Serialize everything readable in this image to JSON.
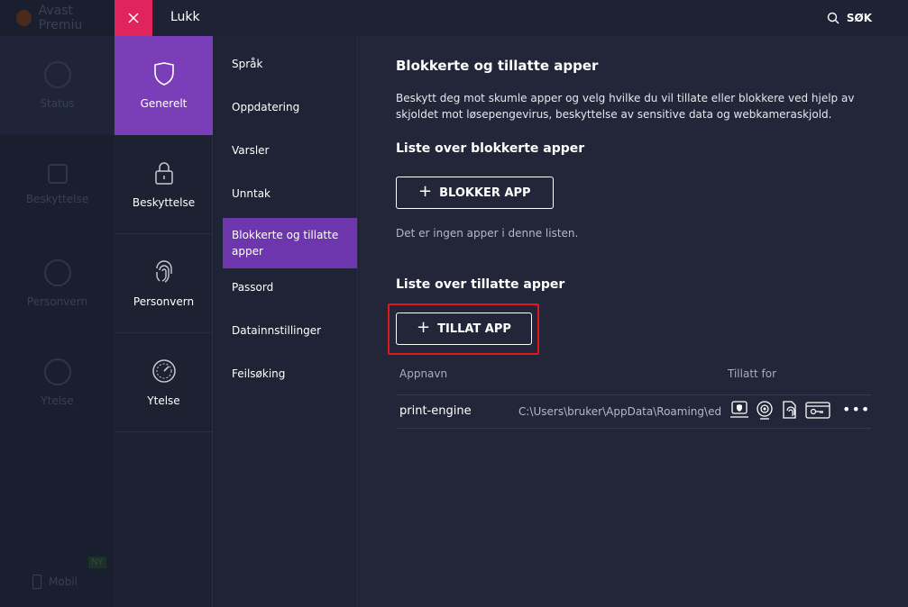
{
  "background_app": {
    "title": "Avast Premiu",
    "nav": [
      "Status",
      "Beskyttelse",
      "Personvern",
      "Ytelse"
    ],
    "mobil": "Mobil",
    "ny_badge": "NY"
  },
  "topbar": {
    "close_label": "Lukk",
    "search_label": "SØK"
  },
  "categories": [
    {
      "label": "Generelt",
      "icon": "shield-icon",
      "active": true
    },
    {
      "label": "Beskyttelse",
      "icon": "lock-icon",
      "active": false
    },
    {
      "label": "Personvern",
      "icon": "fingerprint-icon",
      "active": false
    },
    {
      "label": "Ytelse",
      "icon": "speedometer-icon",
      "active": false
    }
  ],
  "submenu": [
    {
      "label": "Språk",
      "active": false
    },
    {
      "label": "Oppdatering",
      "active": false
    },
    {
      "label": "Varsler",
      "active": false
    },
    {
      "label": "Unntak",
      "active": false
    },
    {
      "label": "Blokkerte og tillatte apper",
      "active": true
    },
    {
      "label": "Passord",
      "active": false
    },
    {
      "label": "Datainnstillinger",
      "active": false
    },
    {
      "label": "Feilsøking",
      "active": false
    }
  ],
  "content": {
    "title": "Blokkerte og tillatte apper",
    "description": "Beskytt deg mot skumle apper og velg hvilke du vil tillate eller blokkere ved hjelp av skjoldet mot løsepengevirus, beskyttelse av sensitive data og webkameraskjold.",
    "blocked_heading": "Liste over blokkerte apper",
    "block_button": "BLOKKER APP",
    "blocked_empty": "Det er ingen apper i denne listen.",
    "allowed_heading": "Liste over tillatte apper",
    "allow_button": "TILLAT APP",
    "table": {
      "col_name": "Appnavn",
      "col_allowed": "Tillatt for",
      "rows": [
        {
          "name": "print-engine",
          "path": "C:\\Users\\bruker\\AppData\\Roaming\\edip",
          "permissions": [
            "ransomware-shield-icon",
            "webcam-shield-icon",
            "sensitive-data-icon",
            "password-protection-icon"
          ]
        }
      ]
    },
    "more_label": "•••"
  },
  "colors": {
    "accent_purple": "#7b3eb9",
    "close_red": "#e1245c",
    "highlight_red": "#e0181e",
    "background": "#222638"
  }
}
